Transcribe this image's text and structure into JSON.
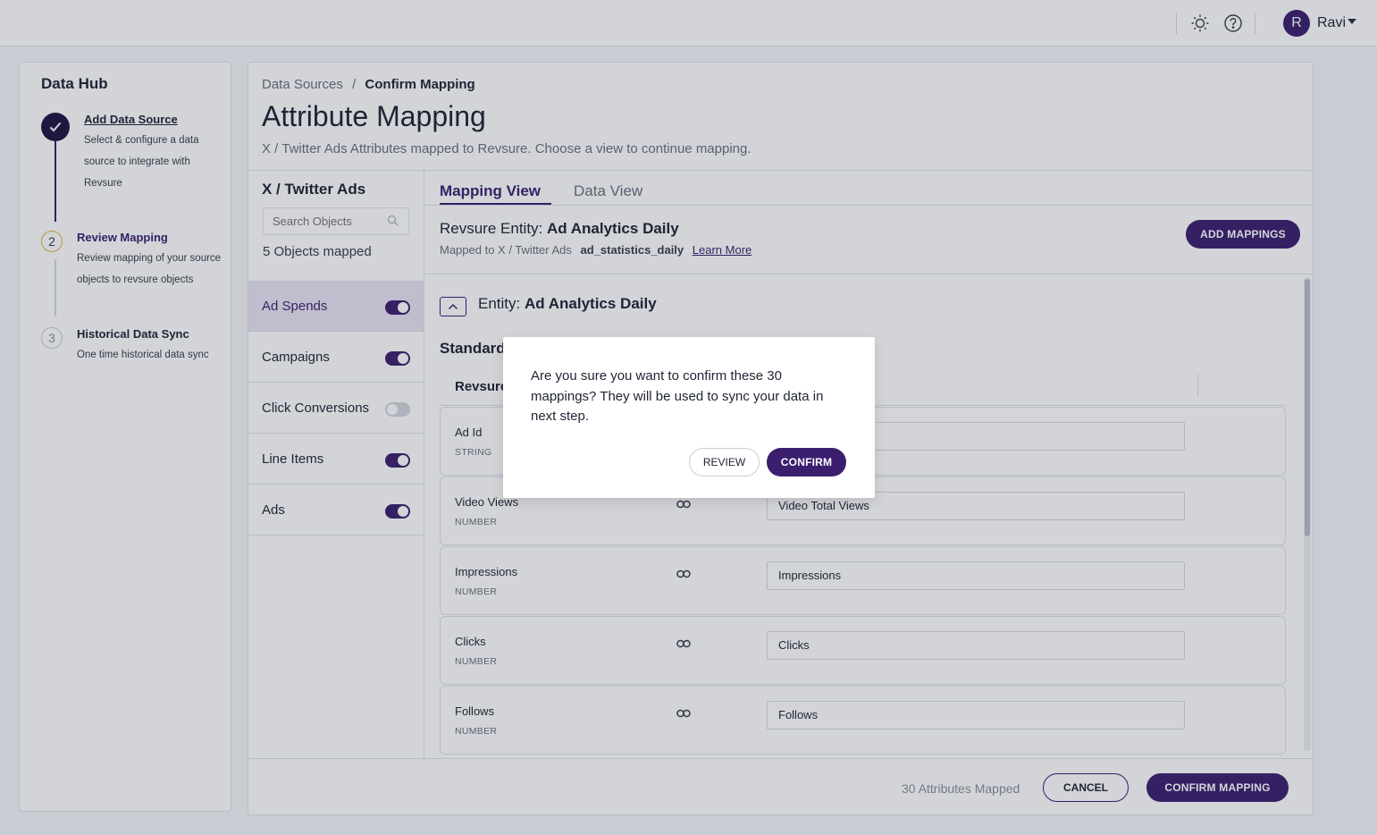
{
  "topbar": {
    "user_initial": "R",
    "user_name": "Ravi"
  },
  "left": {
    "title": "Data Hub",
    "steps": [
      {
        "title": "Add Data Source",
        "desc_lines": [
          "Select & configure a data",
          "source to integrate with",
          "Revsure"
        ]
      },
      {
        "num": "2",
        "title": "Review Mapping",
        "desc_lines": [
          "Review mapping of your source",
          "objects to revsure objects"
        ]
      },
      {
        "num": "3",
        "title": "Historical Data Sync",
        "desc_lines": [
          "One time historical data sync"
        ]
      }
    ]
  },
  "main": {
    "breadcrumb": {
      "parent": "Data Sources",
      "separator": "/",
      "current": "Confirm Mapping"
    },
    "title": "Attribute Mapping",
    "subtitle": "X / Twitter Ads Attributes mapped to Revsure. Choose a view to continue mapping.",
    "objects": {
      "title": "X / Twitter Ads",
      "search_placeholder": "Search Objects",
      "count_label": "5 Objects mapped",
      "items": [
        {
          "label": "Ad Spends",
          "enabled": true
        },
        {
          "label": "Campaigns",
          "enabled": true
        },
        {
          "label": "Click Conversions",
          "enabled": false
        },
        {
          "label": "Line Items",
          "enabled": true
        },
        {
          "label": "Ads",
          "enabled": true
        }
      ]
    },
    "tabs": [
      {
        "label": "Mapping View"
      },
      {
        "label": "Data View"
      }
    ],
    "entity": {
      "prefix": "Revsure Entity:",
      "name": "Ad Analytics Daily",
      "mapped_prefix": "Mapped to X / Twitter Ads",
      "source_table": "ad_statistics_daily",
      "learn_more": "Learn More",
      "add_button": "ADD MAPPINGS",
      "section_prefix": "Entity:",
      "section_name": "Ad Analytics Daily"
    },
    "standard_label": "Standard",
    "column_header": "Revsure",
    "rows": [
      {
        "name": "Ad Id",
        "type": "STRING",
        "mapped": ""
      },
      {
        "name": "Video Views",
        "type": "NUMBER",
        "mapped": "Video Total Views"
      },
      {
        "name": "Impressions",
        "type": "NUMBER",
        "mapped": "Impressions"
      },
      {
        "name": "Clicks",
        "type": "NUMBER",
        "mapped": "Clicks"
      },
      {
        "name": "Follows",
        "type": "NUMBER",
        "mapped": "Follows"
      }
    ],
    "footer": {
      "count": "30 Attributes Mapped",
      "cancel": "CANCEL",
      "confirm": "CONFIRM MAPPING"
    }
  },
  "modal": {
    "message": "Are you sure you want to confirm these 30 mappings? They will be used to sync your data in next step.",
    "review": "REVIEW",
    "confirm": "CONFIRM"
  },
  "colors": {
    "brand": "#3b1f6e",
    "step_done": "#1f1443",
    "step_active_ring": "#e0b43c"
  }
}
